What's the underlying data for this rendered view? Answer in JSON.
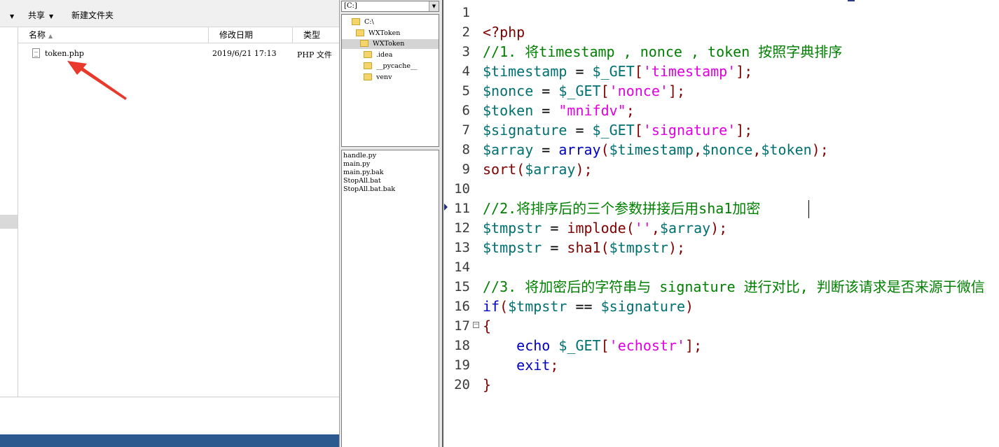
{
  "explorer": {
    "toolbar": {
      "share_label": "共享",
      "new_folder_label": "新建文件夹"
    },
    "columns": {
      "name": "名称",
      "date": "修改日期",
      "type": "类型"
    },
    "files": [
      {
        "name": "token.php",
        "date": "2019/6/21 17:13",
        "type": "PHP 文件"
      }
    ]
  },
  "dir_panel": {
    "drive": "[C:]",
    "tree": [
      {
        "label": "C:\\",
        "depth": 0
      },
      {
        "label": "WXToken",
        "depth": 1
      },
      {
        "label": "WXToken",
        "depth": 2,
        "selected": true
      },
      {
        "label": ".idea",
        "depth": 3
      },
      {
        "label": "__pycache__",
        "depth": 3
      },
      {
        "label": "venv",
        "depth": 3
      }
    ],
    "files": [
      "handle.py",
      "main.py",
      "main.py.bak",
      "StopAll.bat",
      "StopAll.bat.bak"
    ]
  },
  "editor": {
    "colors": {
      "keyword": "#0000c0",
      "variable": "#007070",
      "string": "#e000e0",
      "operator": "#800000",
      "comment": "#008000",
      "plain": "#000000"
    },
    "current_line": 11,
    "folded_line": 17,
    "lines": [
      {
        "n": "1",
        "tokens": []
      },
      {
        "n": "2",
        "tokens": [
          [
            "<?php",
            "operator"
          ]
        ]
      },
      {
        "n": "3",
        "tokens": [
          [
            "//1. 将timestamp , nonce , token 按照字典排序",
            "comment"
          ]
        ]
      },
      {
        "n": "4",
        "tokens": [
          [
            "$timestamp",
            "variable"
          ],
          [
            " = ",
            "plain"
          ],
          [
            "$_GET",
            "variable"
          ],
          [
            "[",
            "operator"
          ],
          [
            "'timestamp'",
            "string"
          ],
          [
            "];",
            "operator"
          ]
        ]
      },
      {
        "n": "5",
        "tokens": [
          [
            "$nonce",
            "variable"
          ],
          [
            " = ",
            "plain"
          ],
          [
            "$_GET",
            "variable"
          ],
          [
            "[",
            "operator"
          ],
          [
            "'nonce'",
            "string"
          ],
          [
            "];",
            "operator"
          ]
        ]
      },
      {
        "n": "6",
        "tokens": [
          [
            "$token",
            "variable"
          ],
          [
            " = ",
            "plain"
          ],
          [
            "\"mnifdv\"",
            "string"
          ],
          [
            ";",
            "operator"
          ]
        ]
      },
      {
        "n": "7",
        "tokens": [
          [
            "$signature",
            "variable"
          ],
          [
            " = ",
            "plain"
          ],
          [
            "$_GET",
            "variable"
          ],
          [
            "[",
            "operator"
          ],
          [
            "'signature'",
            "string"
          ],
          [
            "];",
            "operator"
          ]
        ]
      },
      {
        "n": "8",
        "tokens": [
          [
            "$array",
            "variable"
          ],
          [
            " = ",
            "plain"
          ],
          [
            "array",
            "keyword"
          ],
          [
            "(",
            "operator"
          ],
          [
            "$timestamp",
            "variable"
          ],
          [
            ",",
            "operator"
          ],
          [
            "$nonce",
            "variable"
          ],
          [
            ",",
            "operator"
          ],
          [
            "$token",
            "variable"
          ],
          [
            ");",
            "operator"
          ]
        ]
      },
      {
        "n": "9",
        "tokens": [
          [
            "sort",
            "operator"
          ],
          [
            "(",
            "operator"
          ],
          [
            "$array",
            "variable"
          ],
          [
            ");",
            "operator"
          ]
        ]
      },
      {
        "n": "10",
        "tokens": []
      },
      {
        "n": "11",
        "tokens": [
          [
            "//2.将排序后的三个参数拼接后用sha1加密",
            "comment"
          ]
        ]
      },
      {
        "n": "12",
        "tokens": [
          [
            "$tmpstr",
            "variable"
          ],
          [
            " = ",
            "plain"
          ],
          [
            "implode",
            "operator"
          ],
          [
            "(",
            "operator"
          ],
          [
            "''",
            "string"
          ],
          [
            ",",
            "operator"
          ],
          [
            "$array",
            "variable"
          ],
          [
            ");",
            "operator"
          ]
        ]
      },
      {
        "n": "13",
        "tokens": [
          [
            "$tmpstr",
            "variable"
          ],
          [
            " = ",
            "plain"
          ],
          [
            "sha1",
            "operator"
          ],
          [
            "(",
            "operator"
          ],
          [
            "$tmpstr",
            "variable"
          ],
          [
            ");",
            "operator"
          ]
        ]
      },
      {
        "n": "14",
        "tokens": []
      },
      {
        "n": "15",
        "tokens": [
          [
            "//3. 将加密后的字符串与 signature 进行对比, 判断该请求是否来源于微信",
            "comment"
          ]
        ]
      },
      {
        "n": "16",
        "tokens": [
          [
            "if",
            "keyword"
          ],
          [
            "(",
            "operator"
          ],
          [
            "$tmpstr",
            "variable"
          ],
          [
            " == ",
            "plain"
          ],
          [
            "$signature",
            "variable"
          ],
          [
            ")",
            "operator"
          ]
        ]
      },
      {
        "n": "17",
        "tokens": [
          [
            "{",
            "operator"
          ]
        ]
      },
      {
        "n": "18",
        "tokens": [
          [
            "    ",
            "plain"
          ],
          [
            "echo",
            "keyword"
          ],
          [
            " ",
            "plain"
          ],
          [
            "$_GET",
            "variable"
          ],
          [
            "[",
            "operator"
          ],
          [
            "'echostr'",
            "string"
          ],
          [
            "];",
            "operator"
          ]
        ]
      },
      {
        "n": "19",
        "tokens": [
          [
            "    ",
            "plain"
          ],
          [
            "exit",
            "keyword"
          ],
          [
            ";",
            "operator"
          ]
        ]
      },
      {
        "n": "20",
        "tokens": [
          [
            "}",
            "operator"
          ]
        ]
      }
    ]
  }
}
